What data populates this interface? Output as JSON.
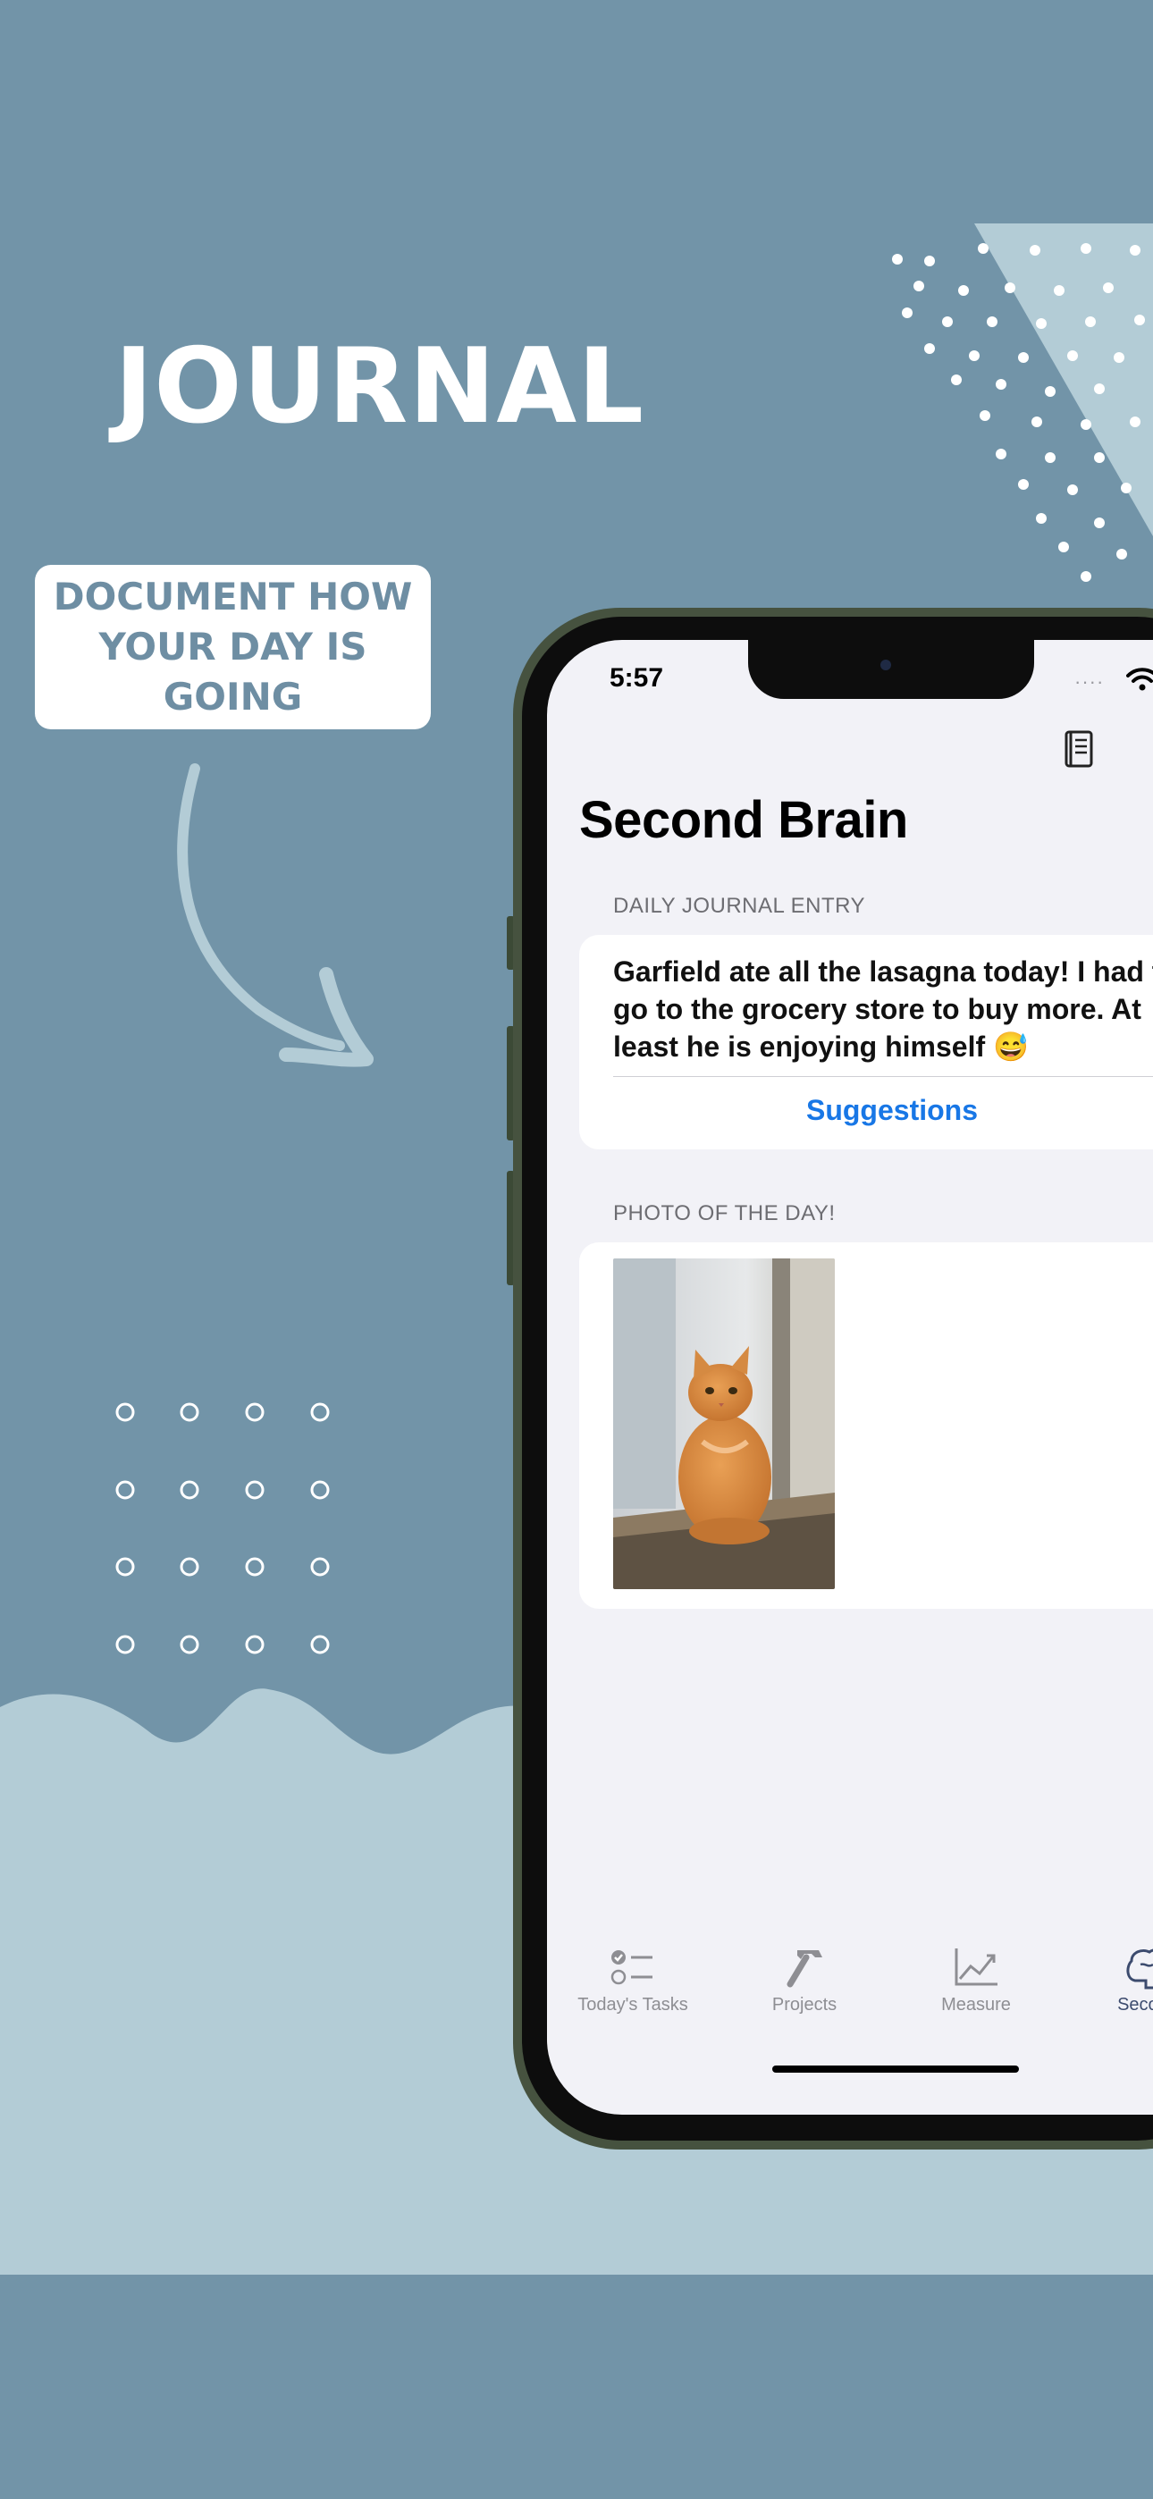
{
  "promo": {
    "headline": "JOURNAL",
    "caption": "DOCUMENT HOW YOUR DAY IS GOING"
  },
  "colors": {
    "background": "#7294a8",
    "wave": "#b3ccd6",
    "caption_text": "#6e8ea3",
    "accent_blue": "#1877e6",
    "phone_frame": "#46523f"
  },
  "status_bar": {
    "time": "5:57",
    "signal": "····",
    "wifi_icon": "wifi-icon"
  },
  "toolbar": {
    "icons": [
      "notebook-icon",
      "gear-icon"
    ]
  },
  "screen": {
    "title": "Second Brain",
    "journal": {
      "header": "DAILY JOURNAL ENTRY",
      "lines": [
        "Garfield ate all the lasagna today! I had to",
        "go to the grocery store to buy more. At",
        "least he is enjoying himself 😅"
      ],
      "suggestions_label": "Suggestions"
    },
    "photo": {
      "header": "PHOTO OF THE DAY!",
      "image": "photo of an orange tabby cat sitting by a window"
    }
  },
  "tabs": [
    {
      "label": "Today's Tasks",
      "icon": "checklist-icon",
      "active": false
    },
    {
      "label": "Projects",
      "icon": "hammer-icon",
      "active": false
    },
    {
      "label": "Measure",
      "icon": "chart-line-icon",
      "active": false
    },
    {
      "label": "Second",
      "icon": "brain-icon",
      "active": true
    }
  ]
}
